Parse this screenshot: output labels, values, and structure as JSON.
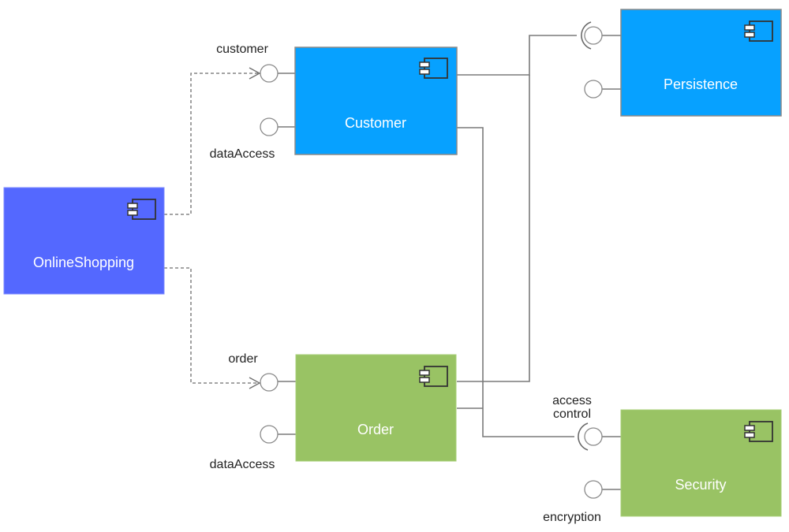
{
  "diagram": {
    "type": "UML component diagram",
    "colors": {
      "online_shopping": "#5468ff",
      "blue_component": "#07a1ff",
      "green_component": "#99c364",
      "border": "#8a8a8a",
      "connector": "#7a7a7a"
    },
    "components": {
      "online_shopping": {
        "name": "OnlineShopping"
      },
      "customer": {
        "name": "Customer"
      },
      "persistence": {
        "name": "Persistence"
      },
      "order": {
        "name": "Order"
      },
      "security": {
        "name": "Security"
      }
    },
    "interfaces": {
      "customer_customer": "customer",
      "customer_data_access": "dataAccess",
      "order_order": "order",
      "order_data_access": "dataAccess",
      "security_access_control_line1": "access",
      "security_access_control_line2": "control",
      "security_encryption": "encryption"
    },
    "icon": "component-icon"
  }
}
